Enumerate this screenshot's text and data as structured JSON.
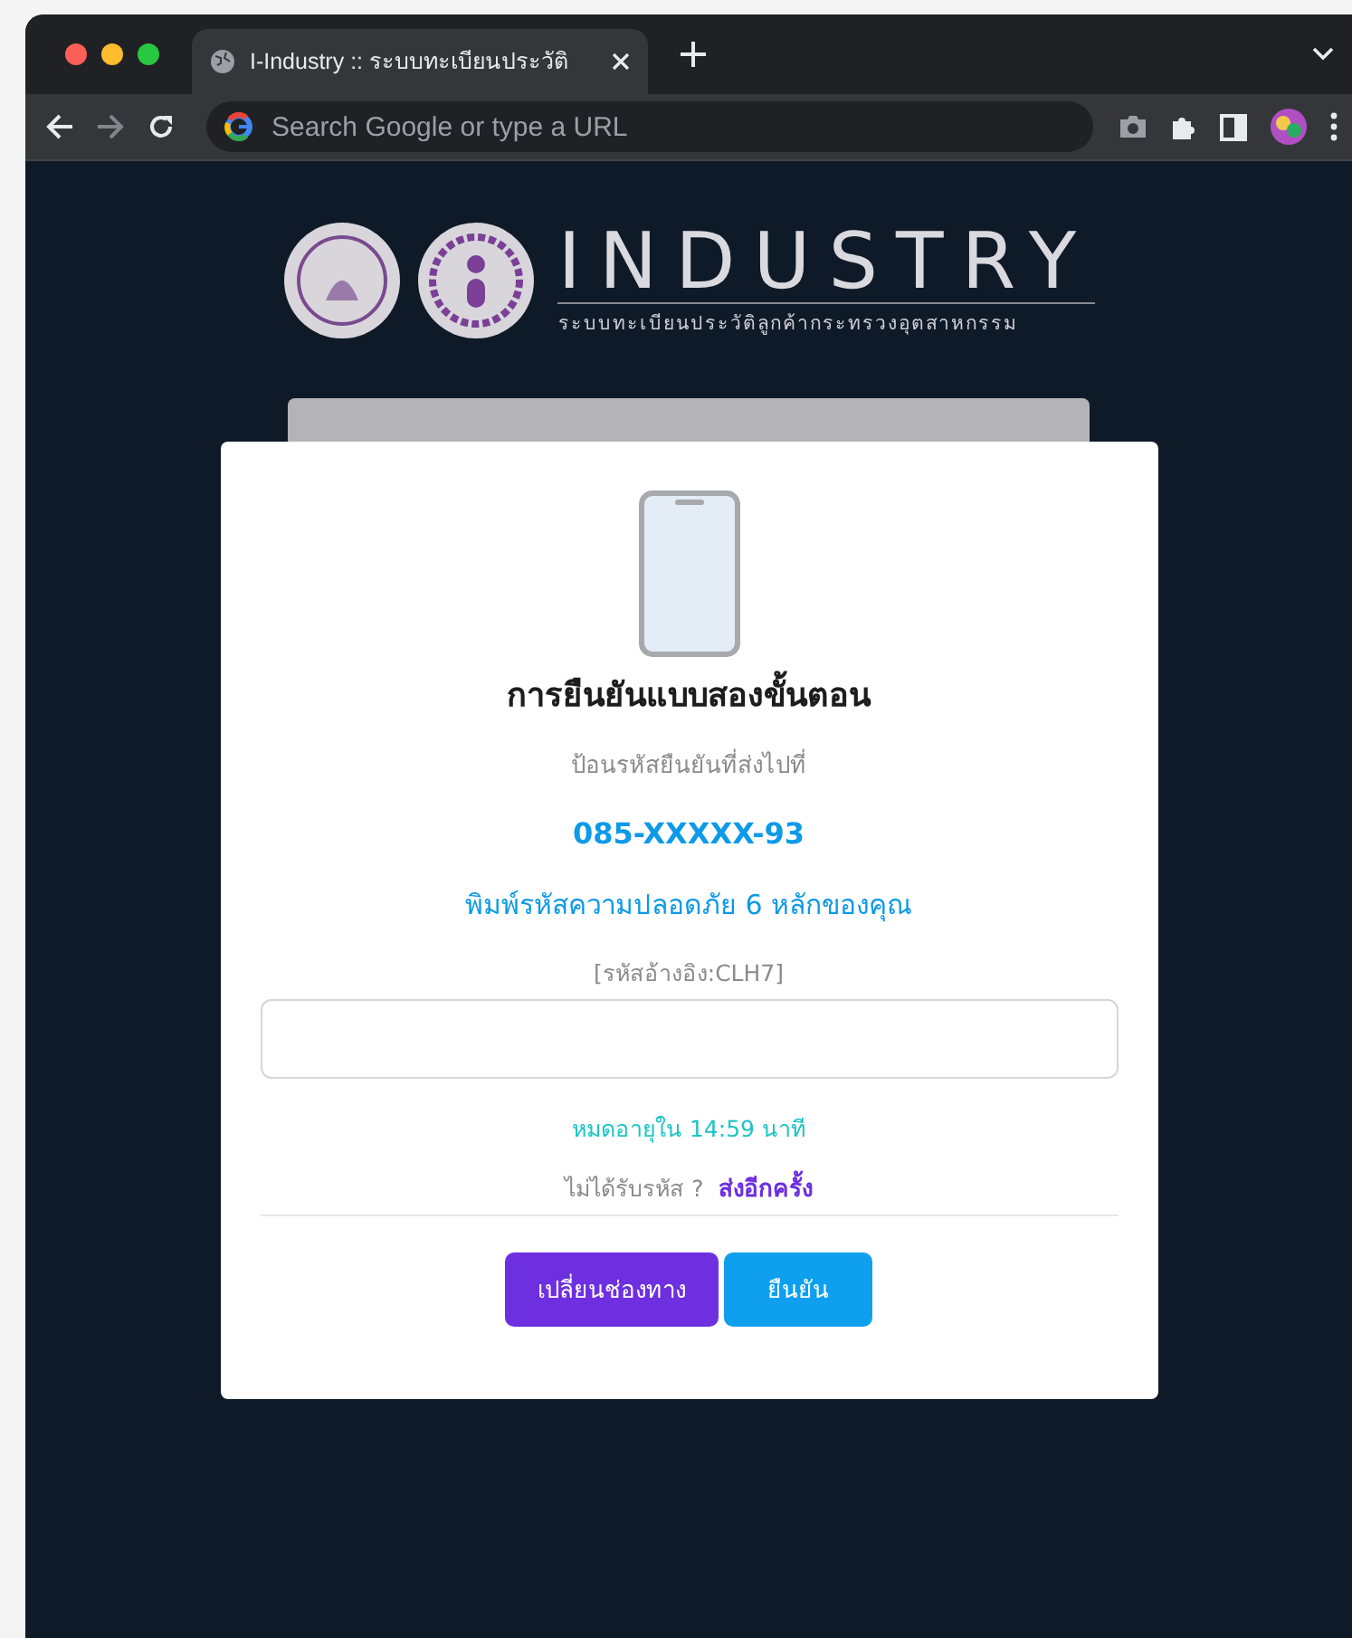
{
  "browser": {
    "tab": {
      "title": "I-Industry :: ระบบทะเบียนประวัติ",
      "selected": true
    },
    "address_bar": {
      "placeholder": "Search Google or type a URL"
    }
  },
  "logo": {
    "title": "INDUSTRY",
    "subtitle": "ระบบทะเบียนประวัติลูกค้ากระทรวงอุตสาหกรรม"
  },
  "card": {
    "heading": "การยืนยันแบบสองขั้นตอน",
    "instruction": "ป้อนรหัสยืนยันที่ส่งไปที่",
    "phone": "085-XXXXX-93",
    "prompt": "พิมพ์รหัสความปลอดภัย 6 หลักของคุณ",
    "reference": "[รหัสอ้างอิง:CLH7]",
    "expiry": "หมดอายุใน 14:59 นาที",
    "resend_question": "ไม่ได้รับรหัส ?",
    "resend_link": "ส่งอีกครั้ง",
    "buttons": [
      {
        "label": "เปลี่ยนช่องทาง",
        "kind": "secondary"
      },
      {
        "label": "ยืนยัน",
        "kind": "primary"
      }
    ]
  }
}
